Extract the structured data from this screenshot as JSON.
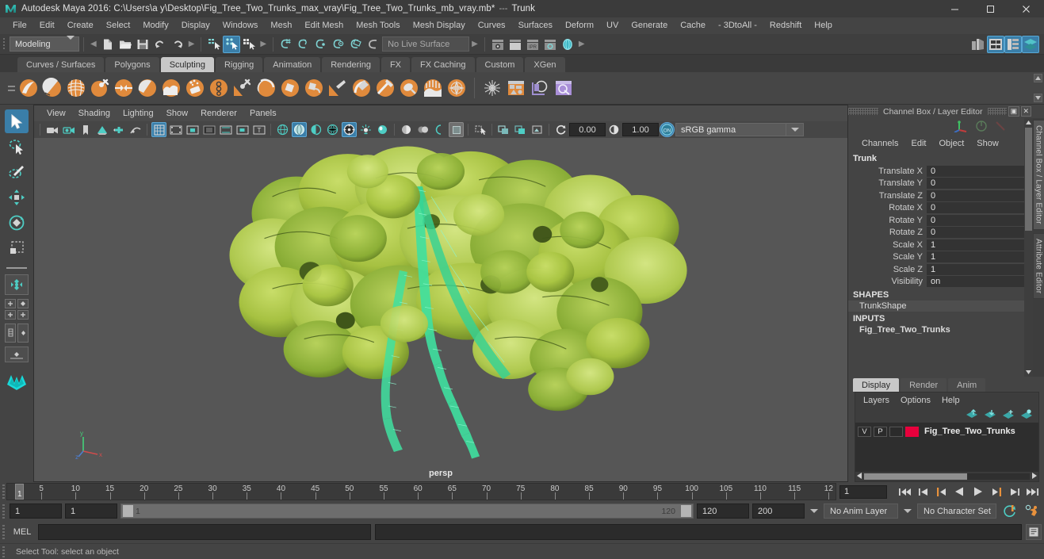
{
  "window": {
    "title": "Autodesk Maya 2016: C:\\Users\\a y\\Desktop\\Fig_Tree_Two_Trunks_max_vray\\Fig_Tree_Two_Trunks_mb_vray.mb*",
    "separator": "---",
    "object": "Trunk",
    "minimize": "–",
    "maximize": "□",
    "close": "✕"
  },
  "menubar": {
    "items": [
      "File",
      "Edit",
      "Create",
      "Select",
      "Modify",
      "Display",
      "Windows",
      "Mesh",
      "Edit Mesh",
      "Mesh Tools",
      "Mesh Display",
      "Curves",
      "Surfaces",
      "Deform",
      "UV",
      "Generate",
      "Cache",
      "- 3DtoAll -",
      "Redshift",
      "Help"
    ]
  },
  "statusline": {
    "menu_set": "Modeling",
    "live_surface": "No Live Surface",
    "icons": [
      "new-scene-icon",
      "open-scene-icon",
      "save-scene-icon",
      "undo-icon",
      "redo-icon",
      "select-hierarchy-icon",
      "select-object-icon",
      "select-component-icon",
      "snap-grid-icon",
      "snap-curve-icon",
      "snap-point-icon",
      "snap-projected-center-icon",
      "snap-view-plane-icon",
      "make-live-icon",
      "show-hide-editor-icon",
      "render-view-icon",
      "render-current-frame-icon",
      "ipr-render-icon",
      "render-settings-icon",
      "hypershade-icon",
      "outliner-icon",
      "attribute-editor-icon",
      "channel-box-layer-icon",
      "modeling-toolkit-icon"
    ]
  },
  "shelf": {
    "tabs": [
      "Curves / Surfaces",
      "Polygons",
      "Sculpting",
      "Rigging",
      "Animation",
      "Rendering",
      "FX",
      "FX Caching",
      "Custom",
      "XGen"
    ],
    "active_tab": "Sculpting",
    "buttons": [
      "sculpt-tool-icon",
      "smooth-tool-icon",
      "relax-tool-icon",
      "grab-tool-icon",
      "pinch-tool-icon",
      "flatten-tool-icon",
      "foamy-tool-icon",
      "spray-tool-icon",
      "repeat-tool-icon",
      "imprint-tool-icon",
      "wax-tool-icon",
      "scrape-tool-icon",
      "fill-tool-icon",
      "knife-tool-icon",
      "smear-tool-icon",
      "bulge-tool-icon",
      "amplify-tool-icon",
      "freeze-tool-icon",
      "convert-tool-icon",
      "mask-tool-icon",
      "snowflake-icon",
      "uv-editor-icon",
      "sculpt-layer-icon",
      "multi-brush-icon"
    ]
  },
  "toolbox": {
    "items": [
      "select-tool",
      "lasso-select-tool",
      "paint-select-tool",
      "move-tool",
      "rotate-tool",
      "scale-tool",
      "last-tool",
      "single-perspective-layout",
      "four-view-layout",
      "persp-outliner-layout",
      "persp-graph-layout",
      "hypershade-layout"
    ],
    "active": "select-tool"
  },
  "viewport": {
    "menus": [
      "View",
      "Shading",
      "Lighting",
      "Show",
      "Renderer",
      "Panels"
    ],
    "toolbar": {
      "exposure": "0.00",
      "gamma": "1.00",
      "color_management": "sRGB gamma",
      "icons": [
        "select-camera-icon",
        "camera-attributes-icon",
        "bookmark-icon",
        "image-plane-icon",
        "two-d-pan-zoom-icon",
        "oclusion-icon",
        "grid-icon",
        "film-gate-icon",
        "resolution-gate-icon",
        "gate-mask-icon",
        "film-origin-icon",
        "safe-action-icon",
        "safe-title-icon",
        "wireframe-icon",
        "smooth-shade-icon",
        "shaded-wireframe-icon",
        "textured-icon",
        "use-all-lights-icon",
        "shadows-icon",
        "screen-space-ao-icon",
        "motion-blur-icon",
        "multisample-icon",
        "isolate-select-icon",
        "xray-icon",
        "xray-joints-icon",
        "xray-active-components-icon",
        "exposure-icon",
        "gamma-icon",
        "color-management-icon"
      ]
    },
    "camera_label": "persp",
    "axis_labels": {
      "x": "x",
      "y": "y",
      "z": "z"
    }
  },
  "channel_box": {
    "panel_title": "Channel Box / Layer Editor",
    "menus": [
      "Channels",
      "Edit",
      "Object",
      "Show"
    ],
    "object_name": "Trunk",
    "attributes": [
      {
        "label": "Translate X",
        "value": "0"
      },
      {
        "label": "Translate Y",
        "value": "0"
      },
      {
        "label": "Translate Z",
        "value": "0"
      },
      {
        "label": "Rotate X",
        "value": "0"
      },
      {
        "label": "Rotate Y",
        "value": "0"
      },
      {
        "label": "Rotate Z",
        "value": "0"
      },
      {
        "label": "Scale X",
        "value": "1"
      },
      {
        "label": "Scale Y",
        "value": "1"
      },
      {
        "label": "Scale Z",
        "value": "1"
      },
      {
        "label": "Visibility",
        "value": "on"
      }
    ],
    "shapes_header": "SHAPES",
    "shape_name": "TrunkShape",
    "inputs_header": "INPUTS",
    "input_name": "Fig_Tree_Two_Trunks"
  },
  "layer_editor": {
    "tabs": [
      "Display",
      "Render",
      "Anim"
    ],
    "active_tab": "Display",
    "menus": [
      "Layers",
      "Options",
      "Help"
    ],
    "toolbar_icons": [
      "new-layer-icon",
      "new-layer-from-selected-icon",
      "add-selected-to-layer-icon",
      "remove-selected-from-layer-icon"
    ],
    "layers": [
      {
        "visibility": "V",
        "playback": "P",
        "type": "",
        "color": "#e8003c",
        "name": "Fig_Tree_Two_Trunks"
      }
    ]
  },
  "side_tabs": [
    {
      "label": "Channel Box / Layer Editor",
      "selected": true
    },
    {
      "label": "Attribute Editor",
      "selected": false
    }
  ],
  "timeline": {
    "tick_labels": [
      "5",
      "10",
      "15",
      "20",
      "25",
      "30",
      "35",
      "40",
      "45",
      "50",
      "55",
      "60",
      "65",
      "70",
      "75",
      "80",
      "85",
      "90",
      "95",
      "100",
      "105",
      "110",
      "115",
      "12"
    ],
    "current_frame": "1",
    "playback_field": "1",
    "transport_buttons": [
      "go-to-start-icon",
      "step-back-keyframe-icon",
      "step-back-frame-icon",
      "play-backwards-icon",
      "play-forwards-icon",
      "step-forward-frame-icon",
      "step-forward-keyframe-icon",
      "go-to-end-icon"
    ]
  },
  "range_slider": {
    "anim_start": "1",
    "playback_start": "1",
    "range_start_label": "1",
    "range_end_label": "120",
    "playback_end": "120",
    "anim_end": "200",
    "anim_layer": "No Anim Layer",
    "character_set": "No Character Set",
    "auto_keyframe_icon": "auto-keyframe-icon",
    "anim_prefs_icon": "animation-preferences-icon"
  },
  "command_line": {
    "language_label": "MEL",
    "input_value": "",
    "output_value": "",
    "script_editor_icon": "script-editor-icon"
  },
  "help_line": {
    "text": "Select Tool: select an object"
  },
  "colors": {
    "accent_blue": "#3a7ea8",
    "shelf_orange": "#e08a3c",
    "teal": "#4ecdc4",
    "layer_red": "#e8003c",
    "background": "#444444"
  }
}
